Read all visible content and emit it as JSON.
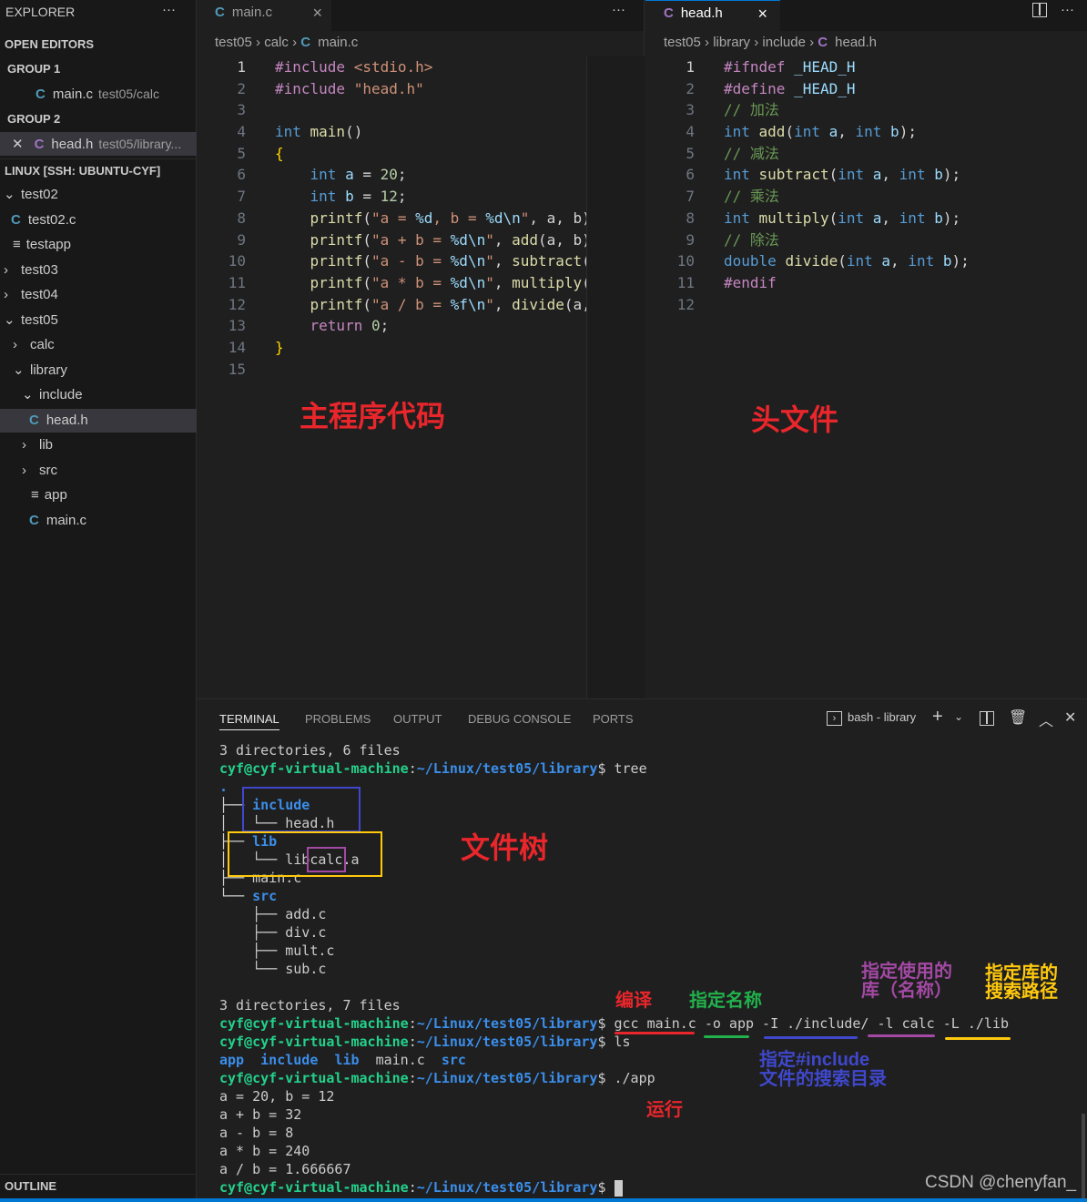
{
  "sidebar": {
    "title": "EXPLORER",
    "more": "···",
    "open_editors": "OPEN EDITORS",
    "group1": "GROUP 1",
    "group1_file": {
      "name": "main.c",
      "desc": "test05/calc"
    },
    "group2": "GROUP 2",
    "group2_file": {
      "name": "head.h",
      "desc": "test05/library..."
    },
    "workspace": "LINUX [SSH: UBUNTU-CYF]",
    "tree": [
      {
        "label": "test02",
        "type": "folder-open",
        "level": 0
      },
      {
        "label": "test02.c",
        "type": "c",
        "level": 0
      },
      {
        "label": "testapp",
        "type": "file",
        "level": 0
      },
      {
        "label": "test03",
        "type": "folder",
        "level": 0
      },
      {
        "label": "test04",
        "type": "folder",
        "level": 0
      },
      {
        "label": "test05",
        "type": "folder-open",
        "level": 0
      },
      {
        "label": "calc",
        "type": "folder",
        "level": 1
      },
      {
        "label": "library",
        "type": "folder-open",
        "level": 1
      },
      {
        "label": "include",
        "type": "folder-open",
        "level": 2
      },
      {
        "label": "head.h",
        "type": "c",
        "level": 2,
        "selected": true
      },
      {
        "label": "lib",
        "type": "folder",
        "level": 2
      },
      {
        "label": "src",
        "type": "folder",
        "level": 2
      },
      {
        "label": "app",
        "type": "file",
        "level": 2
      },
      {
        "label": "main.c",
        "type": "c",
        "level": 2
      }
    ],
    "outline": "OUTLINE"
  },
  "editor1": {
    "tab": "main.c",
    "close": "×",
    "more": "···",
    "breadcrumb": [
      "test05",
      "calc",
      "main.c"
    ],
    "lines": [
      [
        [
          "#include ",
          "p"
        ],
        [
          "<stdio.h>",
          "s"
        ]
      ],
      [
        [
          "#include ",
          "p"
        ],
        [
          "\"head.h\"",
          "s"
        ]
      ],
      [],
      [
        [
          "int ",
          "k"
        ],
        [
          "main",
          "f"
        ],
        [
          "()",
          "t"
        ]
      ],
      [
        [
          "{",
          "b"
        ]
      ],
      [
        [
          "    "
        ],
        [
          "int ",
          "k"
        ],
        [
          "a",
          "v"
        ],
        [
          " = ",
          "t"
        ],
        [
          "20",
          "n"
        ],
        [
          ";",
          "t"
        ]
      ],
      [
        [
          "    "
        ],
        [
          "int ",
          "k"
        ],
        [
          "b",
          "v"
        ],
        [
          " = ",
          "t"
        ],
        [
          "12",
          "n"
        ],
        [
          ";",
          "t"
        ]
      ],
      [
        [
          "    "
        ],
        [
          "printf",
          "f"
        ],
        [
          "(",
          "t"
        ],
        [
          "\"a = ",
          "s"
        ],
        [
          "%d",
          "v"
        ],
        [
          ", b = ",
          "s"
        ],
        [
          "%d\\n",
          "v"
        ],
        [
          "\"",
          "s"
        ],
        [
          ", a, b)",
          "t"
        ]
      ],
      [
        [
          "    "
        ],
        [
          "printf",
          "f"
        ],
        [
          "(",
          "t"
        ],
        [
          "\"a + b = ",
          "s"
        ],
        [
          "%d\\n",
          "v"
        ],
        [
          "\"",
          "s"
        ],
        [
          ", ",
          "t"
        ],
        [
          "add",
          "f"
        ],
        [
          "(a, b)",
          "t"
        ]
      ],
      [
        [
          "    "
        ],
        [
          "printf",
          "f"
        ],
        [
          "(",
          "t"
        ],
        [
          "\"a - b = ",
          "s"
        ],
        [
          "%d\\n",
          "v"
        ],
        [
          "\"",
          "s"
        ],
        [
          ", ",
          "t"
        ],
        [
          "subtract",
          "f"
        ],
        [
          "(",
          "t"
        ]
      ],
      [
        [
          "    "
        ],
        [
          "printf",
          "f"
        ],
        [
          "(",
          "t"
        ],
        [
          "\"a * b = ",
          "s"
        ],
        [
          "%d\\n",
          "v"
        ],
        [
          "\"",
          "s"
        ],
        [
          ", ",
          "t"
        ],
        [
          "multiply",
          "f"
        ],
        [
          "(",
          "t"
        ]
      ],
      [
        [
          "    "
        ],
        [
          "printf",
          "f"
        ],
        [
          "(",
          "t"
        ],
        [
          "\"a / b = ",
          "s"
        ],
        [
          "%f\\n",
          "v"
        ],
        [
          "\"",
          "s"
        ],
        [
          ", ",
          "t"
        ],
        [
          "divide",
          "f"
        ],
        [
          "(a,",
          "t"
        ]
      ],
      [
        [
          "    "
        ],
        [
          "return ",
          "m"
        ],
        [
          "0",
          "n"
        ],
        [
          ";",
          "t"
        ]
      ],
      [
        [
          "}",
          "b"
        ]
      ],
      []
    ],
    "annotation": "主程序代码"
  },
  "editor2": {
    "tab": "head.h",
    "close": "×",
    "more": "···",
    "split": "split-editor",
    "breadcrumb": [
      "test05",
      "library",
      "include",
      "head.h"
    ],
    "lines": [
      [
        [
          "#ifndef ",
          "p"
        ],
        [
          "_HEAD_H",
          "v"
        ]
      ],
      [
        [
          "#define ",
          "p"
        ],
        [
          "_HEAD_H",
          "v"
        ]
      ],
      [
        [
          "// 加法",
          "c"
        ]
      ],
      [
        [
          "int ",
          "k"
        ],
        [
          "add",
          "f"
        ],
        [
          "(",
          "t"
        ],
        [
          "int ",
          "k"
        ],
        [
          "a",
          "v"
        ],
        [
          ", ",
          "t"
        ],
        [
          "int ",
          "k"
        ],
        [
          "b",
          "v"
        ],
        [
          ");",
          "t"
        ]
      ],
      [
        [
          "// 减法",
          "c"
        ]
      ],
      [
        [
          "int ",
          "k"
        ],
        [
          "subtract",
          "f"
        ],
        [
          "(",
          "t"
        ],
        [
          "int ",
          "k"
        ],
        [
          "a",
          "v"
        ],
        [
          ", ",
          "t"
        ],
        [
          "int ",
          "k"
        ],
        [
          "b",
          "v"
        ],
        [
          ");",
          "t"
        ]
      ],
      [
        [
          "// 乘法",
          "c"
        ]
      ],
      [
        [
          "int ",
          "k"
        ],
        [
          "multiply",
          "f"
        ],
        [
          "(",
          "t"
        ],
        [
          "int ",
          "k"
        ],
        [
          "a",
          "v"
        ],
        [
          ", ",
          "t"
        ],
        [
          "int ",
          "k"
        ],
        [
          "b",
          "v"
        ],
        [
          ");",
          "t"
        ]
      ],
      [
        [
          "// 除法",
          "c"
        ]
      ],
      [
        [
          "double ",
          "k"
        ],
        [
          "divide",
          "f"
        ],
        [
          "(",
          "t"
        ],
        [
          "int ",
          "k"
        ],
        [
          "a",
          "v"
        ],
        [
          ", ",
          "t"
        ],
        [
          "int ",
          "k"
        ],
        [
          "b",
          "v"
        ],
        [
          ");",
          "t"
        ]
      ],
      [
        [
          "#endif",
          "p"
        ]
      ],
      []
    ],
    "annotation": "头文件"
  },
  "panel": {
    "tabs": [
      "TERMINAL",
      "PROBLEMS",
      "OUTPUT",
      "DEBUG CONSOLE",
      "PORTS"
    ],
    "shell": "bash - library",
    "lines": [
      [
        [
          "3 directories, 6 files"
        ]
      ],
      [
        [
          "cyf@cyf-virtual-machine",
          "pg"
        ],
        [
          ":"
        ],
        [
          "~/Linux/test05/library",
          "pb"
        ],
        [
          "$ tree"
        ]
      ],
      [
        [
          ".",
          "dir"
        ]
      ],
      [
        [
          "├── "
        ],
        [
          "include",
          "dir"
        ]
      ],
      [
        [
          "│   └── head.h"
        ]
      ],
      [
        [
          "├── "
        ],
        [
          "lib",
          "dir"
        ]
      ],
      [
        [
          "│   └── libcalc.a"
        ]
      ],
      [
        [
          "├── main.c"
        ]
      ],
      [
        [
          "└── "
        ],
        [
          "src",
          "dir"
        ]
      ],
      [
        [
          "    ├── add.c"
        ]
      ],
      [
        [
          "    ├── div.c"
        ]
      ],
      [
        [
          "    ├── mult.c"
        ]
      ],
      [
        [
          "    └── sub.c"
        ]
      ],
      [
        [
          ""
        ]
      ],
      [
        [
          "3 directories, 7 files"
        ]
      ],
      [
        [
          "cyf@cyf-virtual-machine",
          "pg"
        ],
        [
          ":"
        ],
        [
          "~/Linux/test05/library",
          "pb"
        ],
        [
          "$ gcc main.c -o app -I ./include/ -l calc -L ./lib"
        ]
      ],
      [
        [
          "cyf@cyf-virtual-machine",
          "pg"
        ],
        [
          ":"
        ],
        [
          "~/Linux/test05/library",
          "pb"
        ],
        [
          "$ ls"
        ]
      ],
      [
        [
          "app",
          "dir"
        ],
        [
          "  "
        ],
        [
          "include",
          "dir"
        ],
        [
          "  "
        ],
        [
          "lib",
          "dir"
        ],
        [
          "  main.c  "
        ],
        [
          "src",
          "dir"
        ]
      ],
      [
        [
          "cyf@cyf-virtual-machine",
          "pg"
        ],
        [
          ":"
        ],
        [
          "~/Linux/test05/library",
          "pb"
        ],
        [
          "$ ./app"
        ]
      ],
      [
        [
          "a = 20, b = 12"
        ]
      ],
      [
        [
          "a + b = 32"
        ]
      ],
      [
        [
          "a - b = 8"
        ]
      ],
      [
        [
          "a * b = 240"
        ]
      ],
      [
        [
          "a / b = 1.666667"
        ]
      ],
      [
        [
          "cyf@cyf-virtual-machine",
          "pg"
        ],
        [
          ":"
        ],
        [
          "~/Linux/test05/library",
          "pb"
        ],
        [
          "$ "
        ]
      ]
    ],
    "annotations": {
      "tree": "文件树",
      "compile": "编译",
      "name": "指定名称",
      "lib_name": [
        "指定使用的",
        "库（名称）"
      ],
      "lib_path": [
        "指定库的",
        "搜索路径"
      ],
      "include_dir": [
        "指定#include",
        "文件的搜索目录"
      ],
      "run": "运行"
    }
  },
  "colors": {
    "red": "#e8262b",
    "green": "#22b14c",
    "blue": "#3f48cc",
    "purple": "#a349a4",
    "yellow": "#ffc90e",
    "accent": "#0078d4"
  },
  "watermark": "CSDN @chenyfan_"
}
